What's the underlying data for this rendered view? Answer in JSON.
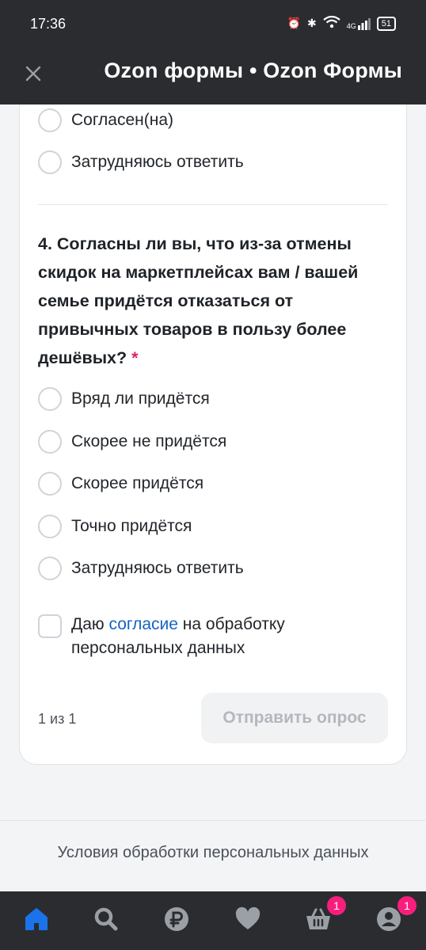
{
  "status_bar": {
    "time": "17:36",
    "network": "4G",
    "battery": "51"
  },
  "header": {
    "title": "Ozon формы • Ozon Формы"
  },
  "prev_options": [
    {
      "label": "Согласен(на)"
    },
    {
      "label": "Затрудняюсь ответить"
    }
  ],
  "question4": {
    "text": "4. Согласны ли вы, что из-за отмены скидок на маркетплейсах вам / вашей семье придётся отказаться от привычных товаров в пользу более дешёвых?",
    "required_mark": "*",
    "options": [
      {
        "label": "Вряд ли придётся"
      },
      {
        "label": "Скорее не придётся"
      },
      {
        "label": "Скорее придётся"
      },
      {
        "label": "Точно придётся"
      },
      {
        "label": "Затрудняюсь ответить"
      }
    ]
  },
  "consent": {
    "prefix": "Даю ",
    "link": "согласие",
    "suffix": " на обработку персональных данных"
  },
  "pager": "1 из 1",
  "submit_label": "Отправить опрос",
  "footer_link": "Условия обработки персональных данных",
  "nav": {
    "badges": {
      "cart": "1",
      "profile": "1"
    }
  },
  "colors": {
    "accent": "#005bff",
    "badge": "#f91e7d",
    "link": "#1565c0"
  }
}
